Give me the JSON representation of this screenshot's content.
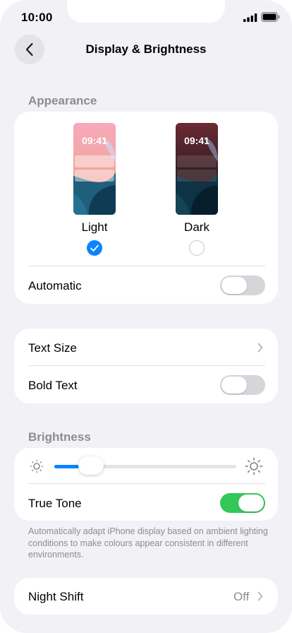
{
  "status_bar": {
    "time": "10:00"
  },
  "nav": {
    "title": "Display & Brightness",
    "back_icon": "chevron-left-icon"
  },
  "appearance": {
    "section_label": "Appearance",
    "options": [
      {
        "label": "Light",
        "preview_time": "09:41",
        "selected": true
      },
      {
        "label": "Dark",
        "preview_time": "09:41",
        "selected": false
      }
    ],
    "automatic": {
      "label": "Automatic",
      "on": false
    }
  },
  "text": {
    "text_size": {
      "label": "Text Size"
    },
    "bold_text": {
      "label": "Bold Text",
      "on": false
    }
  },
  "brightness": {
    "section_label": "Brightness",
    "level": 0.2,
    "true_tone": {
      "label": "True Tone",
      "on": true
    },
    "footnote": "Automatically adapt iPhone display based on ambient lighting conditions to make colours appear consistent in different environments."
  },
  "night_shift": {
    "label": "Night Shift",
    "value": "Off"
  },
  "colors": {
    "accent": "#0a84ff",
    "toggle_on": "#34c759",
    "toggle_off": "#d5d5da",
    "background": "#f2f1f6"
  }
}
